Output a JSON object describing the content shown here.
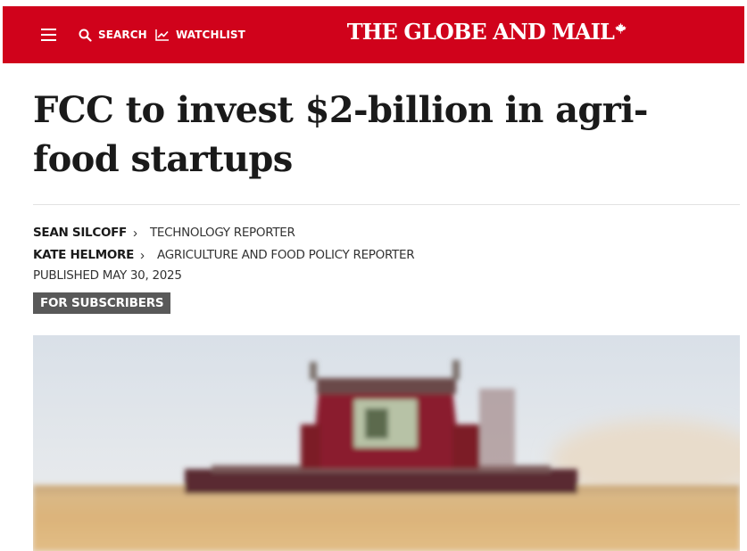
{
  "header": {
    "menu_icon": "hamburger-icon",
    "search_label": "SEARCH",
    "search_icon": "search-icon",
    "watchlist_label": "WATCHLIST",
    "watchlist_icon": "trend-line-icon",
    "logo_text": "THE GLOBE AND MAIL",
    "logo_icon": "maple-leaf-icon",
    "bar_color": "#d0021b"
  },
  "article": {
    "headline": "FCC to invest $2-billion in agri-food startups",
    "bylines": [
      {
        "author": "SEAN SILCOFF",
        "role": "TECHNOLOGY REPORTER"
      },
      {
        "author": "KATE HELMORE",
        "role": "AGRICULTURE AND FOOD POLICY REPORTER"
      }
    ],
    "published": "PUBLISHED MAY 30, 2025",
    "badge": "FOR SUBSCRIBERS",
    "badge_color": "#595959"
  }
}
